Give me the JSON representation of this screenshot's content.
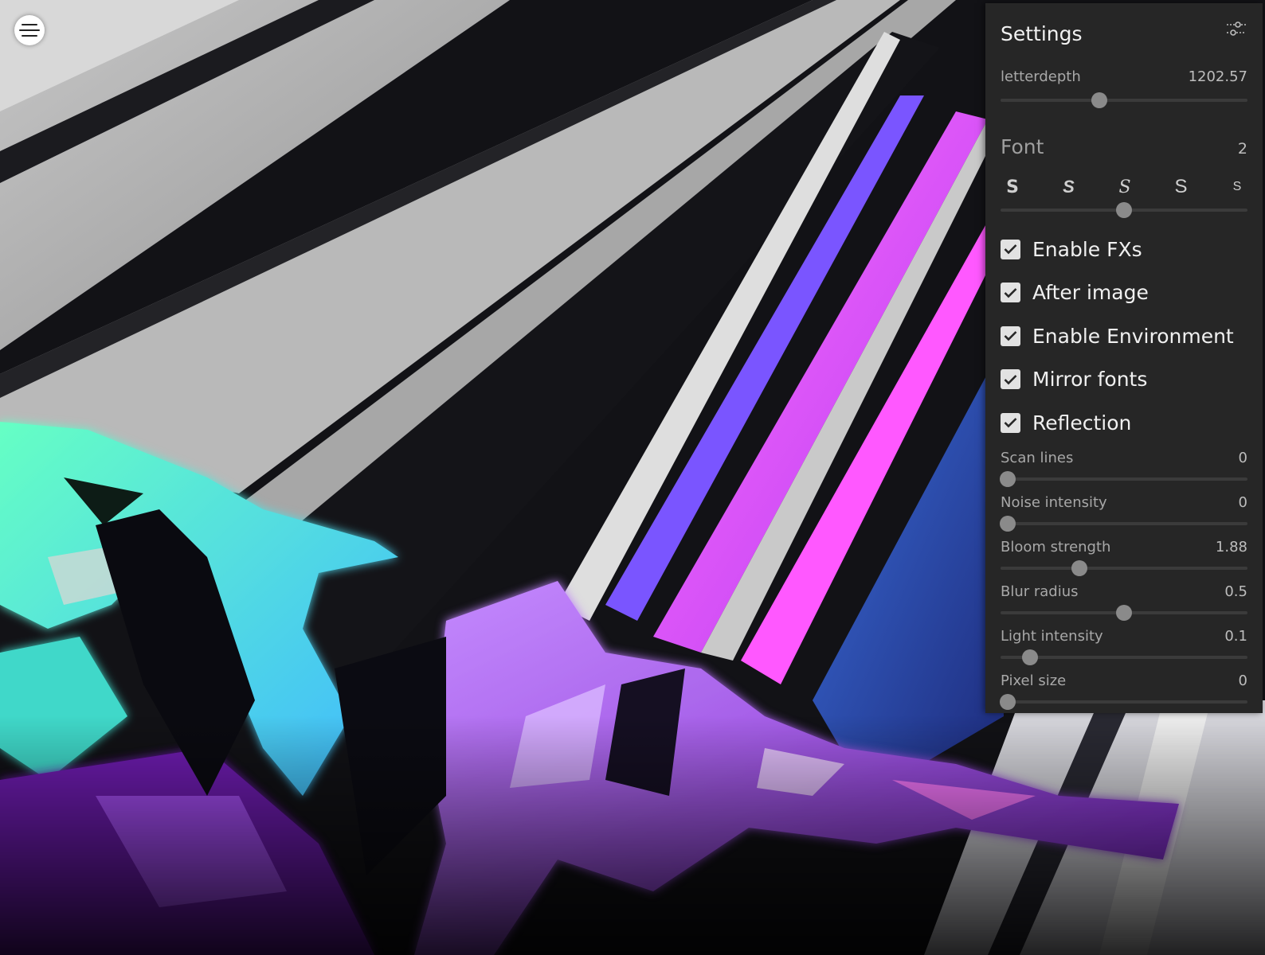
{
  "settings": {
    "title": "Settings",
    "header_icon": "sliders-icon",
    "letterdepth": {
      "label": "letterdepth",
      "value": "1202.57",
      "fraction": 0.4
    },
    "font": {
      "label": "Font",
      "value": "2",
      "glyphs": [
        "S",
        "S",
        "S",
        "S",
        "S"
      ],
      "fraction": 0.5
    },
    "checkboxes": [
      {
        "label": "Enable FXs",
        "checked": true
      },
      {
        "label": "After image",
        "checked": true
      },
      {
        "label": "Enable Environment",
        "checked": true
      },
      {
        "label": "Mirror fonts",
        "checked": true
      },
      {
        "label": "Reflection",
        "checked": true
      }
    ],
    "fx_sliders": [
      {
        "label": "Scan lines",
        "value": "0",
        "fraction": 0.03
      },
      {
        "label": "Noise intensity",
        "value": "0",
        "fraction": 0.03
      },
      {
        "label": "Bloom strength",
        "value": "1.88",
        "fraction": 0.32
      },
      {
        "label": "Blur radius",
        "value": "0.5",
        "fraction": 0.5
      },
      {
        "label": "Light intensity",
        "value": "0.1",
        "fraction": 0.12
      },
      {
        "label": "Pixel size",
        "value": "0",
        "fraction": 0.03
      }
    ]
  },
  "menu": {
    "icon": "menu-icon"
  },
  "colors": {
    "panel_bg": "#262626",
    "thumb": "#8a8a8a",
    "track": "#3b3b3b",
    "neon_green": "#5ef5b8",
    "neon_purple": "#b05cff",
    "neon_magenta": "#e84cff"
  }
}
